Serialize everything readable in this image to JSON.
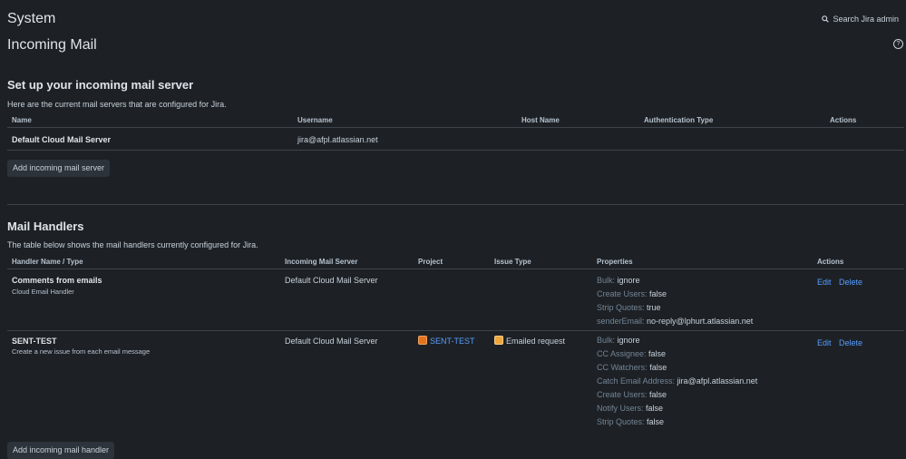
{
  "header": {
    "system_title": "System",
    "page_title": "Incoming Mail",
    "search_label": "Search Jira admin",
    "help_icon": "question-circle-icon"
  },
  "mail_servers": {
    "title": "Set up your incoming mail server",
    "description": "Here are the current mail servers that are configured for Jira.",
    "columns": [
      "Name",
      "Username",
      "Host Name",
      "Authentication Type",
      "Actions"
    ],
    "rows": [
      {
        "name": "Default Cloud Mail Server",
        "username": "jira@afpl.atlassian.net",
        "host": "",
        "auth": "",
        "actions": ""
      }
    ],
    "add_button": "Add incoming mail server"
  },
  "mail_handlers": {
    "title": "Mail Handlers",
    "description": "The table below shows the mail handlers currently configured for Jira.",
    "columns": [
      "Handler Name / Type",
      "Incoming Mail Server",
      "Project",
      "Issue Type",
      "Properties",
      "Actions"
    ],
    "rows": [
      {
        "name": "Comments from emails",
        "type": "Cloud Email Handler",
        "server": "Default Cloud Mail Server",
        "project": "",
        "issue_type": "",
        "properties": [
          {
            "key": "Bulk:",
            "value": "ignore"
          },
          {
            "key": "Create Users:",
            "value": "false"
          },
          {
            "key": "Strip Quotes:",
            "value": "true"
          },
          {
            "key": "senderEmail:",
            "value": "no-reply@lphurt.atlassian.net"
          }
        ],
        "edit": "Edit",
        "delete": "Delete"
      },
      {
        "name": "SENT-TEST",
        "type": "Create a new issue from each email message",
        "server": "Default Cloud Mail Server",
        "project": "SENT-TEST",
        "issue_type": "Emailed request",
        "properties": [
          {
            "key": "Bulk:",
            "value": "ignore"
          },
          {
            "key": "CC Assignee:",
            "value": "false"
          },
          {
            "key": "CC Watchers:",
            "value": "false"
          },
          {
            "key": "Catch Email Address:",
            "value": "jira@afpl.atlassian.net"
          },
          {
            "key": "Create Users:",
            "value": "false"
          },
          {
            "key": "Notify Users:",
            "value": "false"
          },
          {
            "key": "Strip Quotes:",
            "value": "false"
          }
        ],
        "edit": "Edit",
        "delete": "Delete"
      }
    ],
    "add_button": "Add incoming mail handler"
  },
  "colors": {
    "background": "#1d2125",
    "link": "#579dff",
    "text": "#c7d1db"
  }
}
